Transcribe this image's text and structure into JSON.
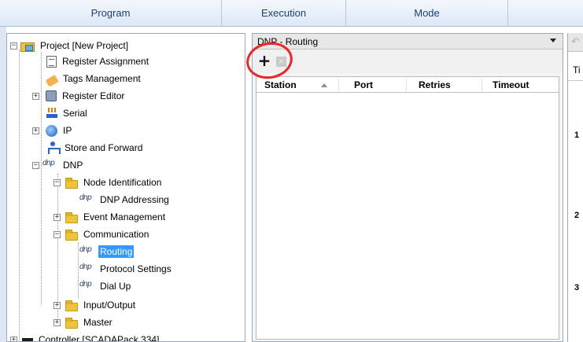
{
  "menu": [
    "Program",
    "Execution",
    "Mode",
    ""
  ],
  "tree": {
    "project": "Project [New Project]",
    "register_assignment": "Register Assignment",
    "tags_management": "Tags Management",
    "register_editor": "Register Editor",
    "serial": "Serial",
    "ip": "IP",
    "store_and_forward": "Store and Forward",
    "dnp": "DNP",
    "node_identification": "Node Identification",
    "dnp_addressing": "DNP Addressing",
    "event_management": "Event Management",
    "communication": "Communication",
    "routing": "Routing",
    "protocol_settings": "Protocol Settings",
    "dial_up": "Dial Up",
    "input_output": "Input/Output",
    "master": "Master",
    "controller": "Controller [SCADAPack 334]",
    "dnp_icon_text": "dnp",
    "expand_glyph": "+",
    "collapse_glyph": "−"
  },
  "routing_panel": {
    "title": "DNP - Routing",
    "add_label": "+",
    "delete_label": "×",
    "columns": [
      "Station",
      "Port",
      "Retries",
      "Timeout"
    ]
  },
  "right_panel": {
    "undo_glyph": "↶",
    "ti_label": "Ti",
    "row_numbers": [
      "1",
      "2",
      "3"
    ]
  },
  "colors": {
    "selection": "#3399ff",
    "annotation": "#e8262a",
    "menu_text": "#1f3f73"
  }
}
